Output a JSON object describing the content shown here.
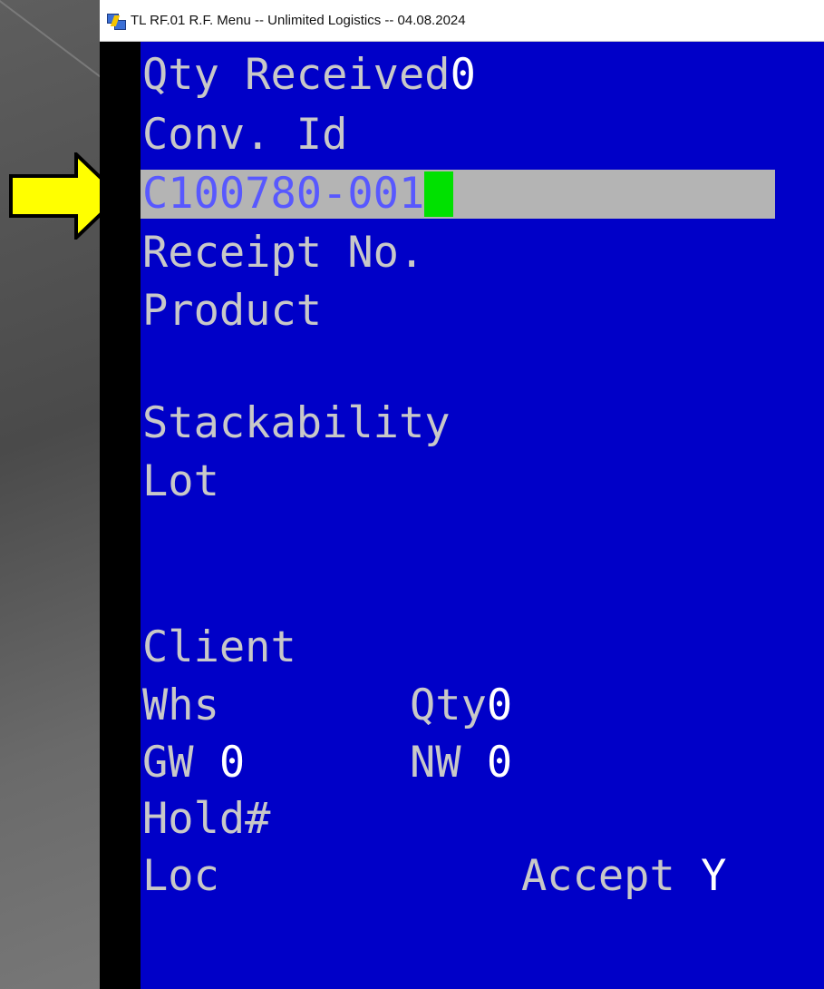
{
  "window": {
    "title": "TL RF.01 R.F. Menu -- Unlimited Logistics -- 04.08.2024",
    "icon": "terminal-app-icon"
  },
  "screen": {
    "qty_received_label": "Qty Received",
    "qty_received_value": "0",
    "conv_id_label": "Conv. Id",
    "conv_id_value": "C100780-001",
    "receipt_no_label": "Receipt No.",
    "product_label": "Product",
    "stackability_label": "Stackability",
    "lot_label": "Lot",
    "client_label": "Client",
    "whs_label": "Whs",
    "qty_label": "Qty",
    "qty_value": "0",
    "gw_label": "GW",
    "gw_value": "0",
    "nw_label": "NW",
    "nw_value": "0",
    "hold_label": "Hold#",
    "loc_label": "Loc",
    "accept_label": "Accept",
    "accept_value": "Y"
  },
  "colors": {
    "terminal_bg": "#0000c8",
    "label_text": "#c8c8c8",
    "value_text": "#ffffff",
    "field_highlight": "#b4b4b4",
    "cursor": "#00e100",
    "arrow": "#ffff00"
  },
  "annotation": {
    "icon": "yellow-arrow-icon"
  }
}
